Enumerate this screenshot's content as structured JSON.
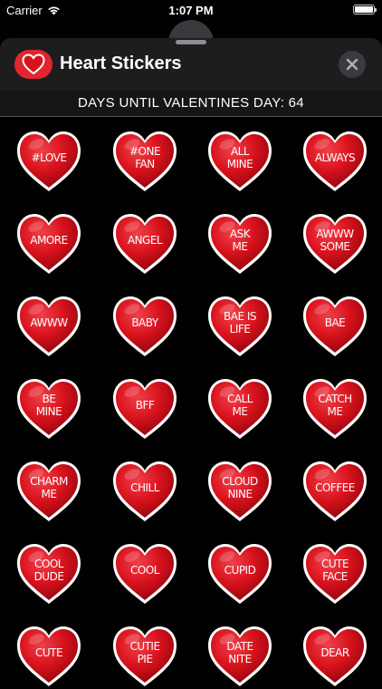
{
  "status_bar": {
    "carrier": "Carrier",
    "time": "1:07 PM"
  },
  "header": {
    "title": "Heart Stickers",
    "app_icon": "heart-icon",
    "close_icon": "close-icon"
  },
  "countdown": {
    "text": "DAYS UNTIL VALENTINES DAY: 64"
  },
  "colors": {
    "heart_red": "#d8121c",
    "heart_outline": "#ffffff",
    "header_bg": "#1d1d20"
  },
  "stickers": [
    {
      "label": "#LOVE"
    },
    {
      "label": "#ONE\nFAN"
    },
    {
      "label": "ALL\nMINE"
    },
    {
      "label": "ALWAYS"
    },
    {
      "label": "AMORE"
    },
    {
      "label": "ANGEL"
    },
    {
      "label": "ASK\nME"
    },
    {
      "label": "AWWW\nSOME"
    },
    {
      "label": "AWWW"
    },
    {
      "label": "BABY"
    },
    {
      "label": "BAE IS\nLIFE"
    },
    {
      "label": "BAE"
    },
    {
      "label": "BE\nMINE"
    },
    {
      "label": "BFF"
    },
    {
      "label": "CALL\nME"
    },
    {
      "label": "CATCH\nME"
    },
    {
      "label": "CHARM\nME"
    },
    {
      "label": "CHILL"
    },
    {
      "label": "CLOUD\nNINE"
    },
    {
      "label": "COFFEE"
    },
    {
      "label": "COOL\nDUDE"
    },
    {
      "label": "COOL"
    },
    {
      "label": "CUPID"
    },
    {
      "label": "CUTE\nFACE"
    },
    {
      "label": "CUTE"
    },
    {
      "label": "CUTIE\nPIE"
    },
    {
      "label": "DATE\nNITE"
    },
    {
      "label": "DEAR"
    }
  ]
}
